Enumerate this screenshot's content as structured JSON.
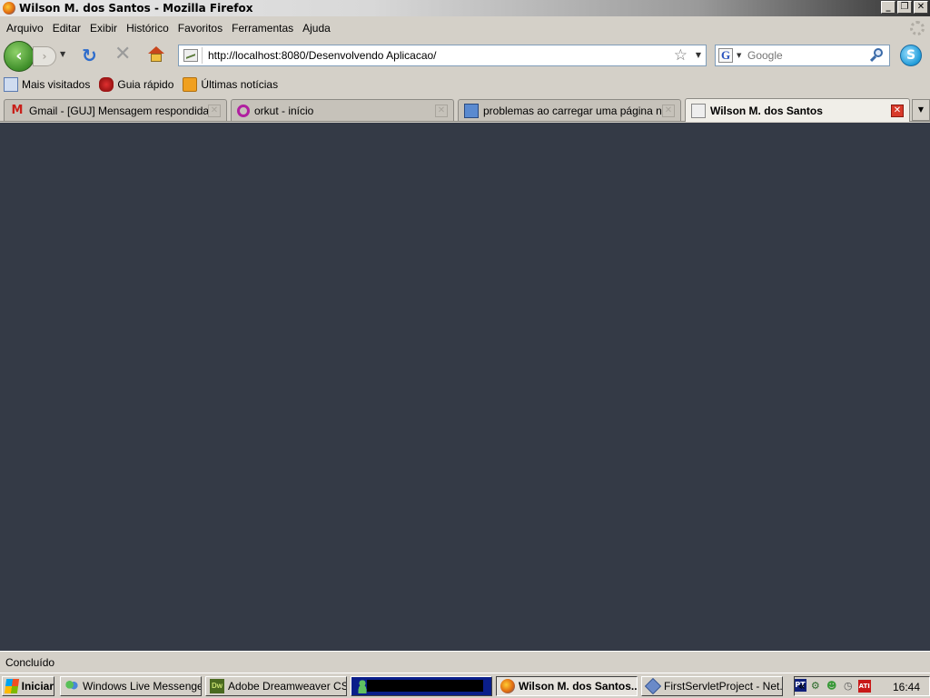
{
  "window": {
    "title": "Wilson M. dos Santos - Mozilla Firefox",
    "buttons": {
      "minimize": "_",
      "maximize": "❐",
      "close": "✕"
    }
  },
  "menu": [
    "Arquivo",
    "Editar",
    "Exibir",
    "Histórico",
    "Favoritos",
    "Ferramentas",
    "Ajuda"
  ],
  "nav": {
    "url": "http://localhost:8080/Desenvolvendo Aplicacao/",
    "search_placeholder": "Google",
    "search_engine_letter": "G"
  },
  "bookmarks": [
    "Mais visitados",
    "Guia rápido",
    "Últimas notícias"
  ],
  "tabs": [
    {
      "label": "Gmail - [GUJ] Mensagem respondida: pr...",
      "favicon": "gmail-icon",
      "active": false
    },
    {
      "label": "orkut - início",
      "favicon": "orkut-icon",
      "active": false
    },
    {
      "label": "problemas ao carregar uma página no t...",
      "favicon": "guj-icon",
      "active": false
    },
    {
      "label": "Wilson M. dos Santos",
      "favicon": "image-icon",
      "active": true
    }
  ],
  "content": {
    "background": "#343a46"
  },
  "status": {
    "text": "Concluído"
  },
  "taskbar": {
    "start_label": "Iniciar",
    "tasks": [
      {
        "label": "Windows Live Messenger",
        "icon": "messenger-icon"
      },
      {
        "label": "Adobe Dreamweaver CS...",
        "icon": "dreamweaver-icon"
      },
      {
        "label": "",
        "icon": "contact-icon"
      },
      {
        "label": "Wilson M. dos Santos...",
        "icon": "firefox-icon",
        "active": true
      },
      {
        "label": "FirstServletProject - Net...",
        "icon": "netbeans-icon"
      }
    ],
    "language": "PT",
    "clock": "16:44"
  }
}
